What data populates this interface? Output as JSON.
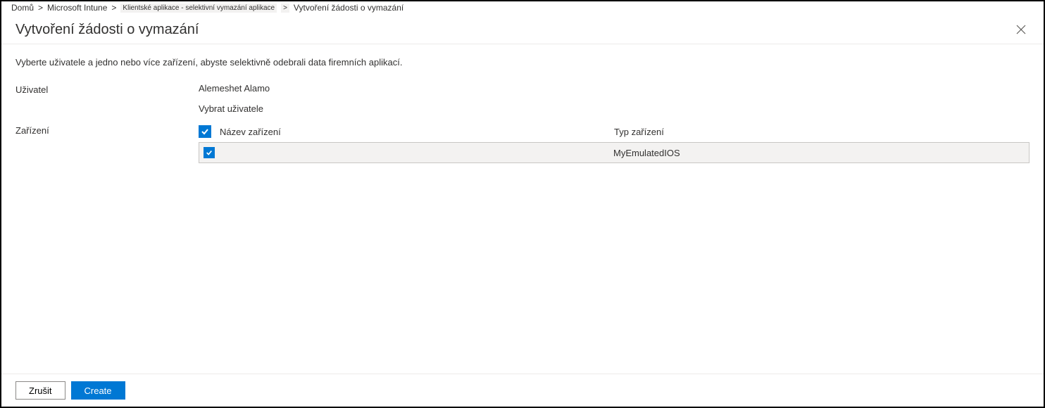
{
  "breadcrumb": {
    "home": "Domů",
    "sep": "&gt;",
    "intune": "Microsoft Intune",
    "apps": "Klientské aplikace - selektivní vymazání aplikace",
    "current": "Vytvoření žádosti o vymazání"
  },
  "header": {
    "title": "Vytvoření žádosti o vymazání"
  },
  "description": "Vyberte uživatele a jedno nebo více zařízení, abyste selektivně odebrali data firemních aplikací.",
  "form": {
    "user_label": "Uživatel",
    "user_value": "Alemeshet Alamo",
    "select_user": "Vybrat uživatele",
    "device_label": "Zařízení"
  },
  "table": {
    "headers": {
      "name": "Název zařízení",
      "type": "Typ zařízení"
    },
    "rows": [
      {
        "name": "",
        "type": "MyEmulatedIOS"
      }
    ]
  },
  "footer": {
    "cancel": "Zrušit",
    "create": "Create"
  }
}
